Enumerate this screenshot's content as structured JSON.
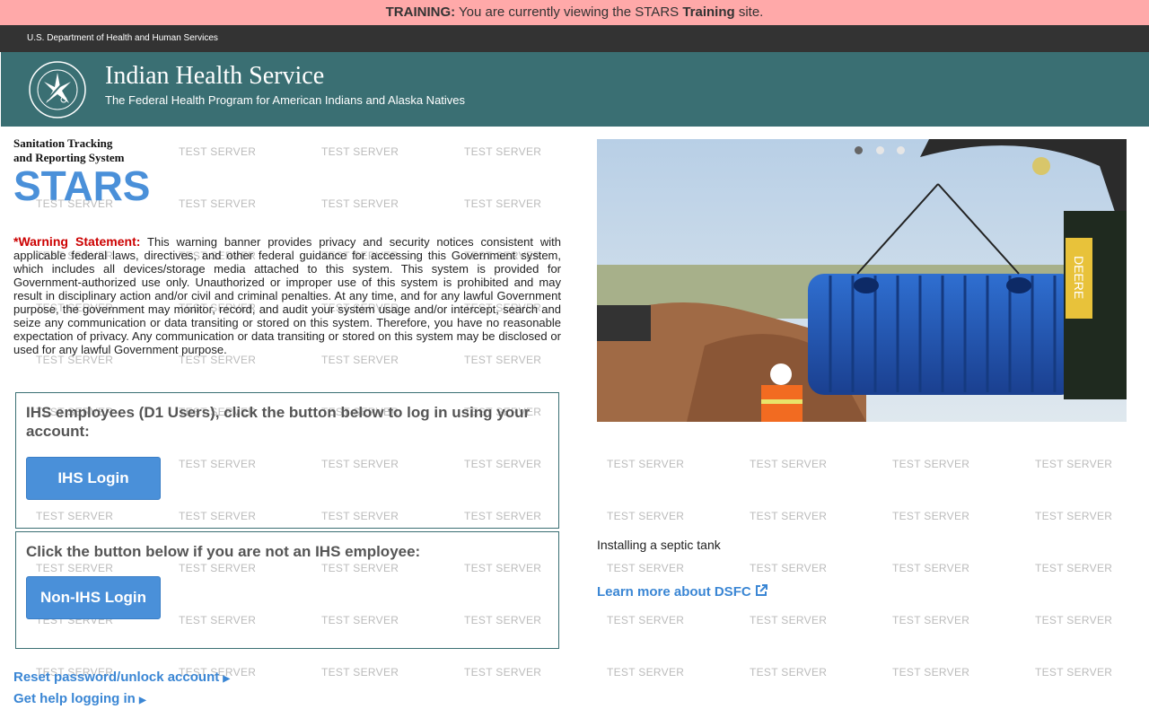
{
  "training_banner": {
    "prefix": "TRAINING:",
    "message": "You are currently viewing the STARS",
    "emphasis": "Training",
    "suffix": "site."
  },
  "hhs_label": "U.S. Department of Health and Human Services",
  "header": {
    "title": "Indian Health Service",
    "subtitle": "The Federal Health Program for American Indians and Alaska Natives",
    "seal_text": "INDIAN HEALTH SERVICE · PHS · 1955",
    "seal_icon": "ihs-seal-icon"
  },
  "watermark_text": "TEST SERVER",
  "app": {
    "name_line1": "Sanitation Tracking",
    "name_line2": "and Reporting System",
    "abbr": "STARS"
  },
  "warning": {
    "label": "*Warning Statement:",
    "text": "This warning banner provides privacy and security notices consistent with applicable federal laws, directives, and other federal guidance for accessing this Government system, which includes all devices/storage media attached to this system. This system is provided for Government-authorized use only. Unauthorized or improper use of this system is prohibited and may result in disciplinary action and/or civil and criminal penalties. At any time, and for any lawful Government purpose, the government may monitor, record, and audit your system usage and/or intercept, search and seize any communication or data transiting or stored on this system. Therefore, you have no reasonable expectation of privacy. Any communication or data transiting or stored on this system may be disclosed or used for any lawful Government purpose."
  },
  "ihs_box": {
    "prompt": "IHS employees (D1 Users), click the button below to log in using your account:",
    "button": "IHS Login"
  },
  "non_ihs_box": {
    "prompt": "Click the button below if you are not an IHS employee:",
    "button": "Non-IHS Login"
  },
  "links": {
    "reset": "Reset password/unlock account",
    "help": "Get help logging in"
  },
  "carousel": {
    "active_slide": 1,
    "slide_count": 3,
    "caption": "Installing a septic tank",
    "equipment_label": "DEERE"
  },
  "dsfc_link": "Learn more about DSFC",
  "colors": {
    "training_bg": "#ffa9a9",
    "banner_bg": "#3a6f73",
    "accent_blue": "#4a90d9",
    "warning_red": "#cc0000"
  }
}
